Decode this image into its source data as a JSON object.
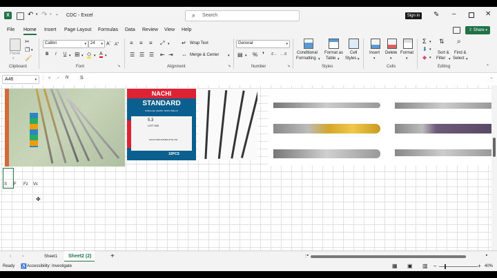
{
  "title": {
    "doc": "CDC",
    "app": "Excel"
  },
  "search": {
    "placeholder": "Search"
  },
  "account": {
    "sign_in": "Sign in"
  },
  "menu": [
    "File",
    "Home",
    "Insert",
    "Page Layout",
    "Formulas",
    "Data",
    "Review",
    "View",
    "Help"
  ],
  "share": "Share",
  "ribbon": {
    "paste": "Paste",
    "font_name": "Calibri",
    "font_size": "24",
    "wrap_text": "Wrap Text",
    "merge_center": "Merge & Center",
    "number_format": "General",
    "conditional": [
      "Conditional",
      "Formatting"
    ],
    "format_as_table": [
      "Format as",
      "Table"
    ],
    "cell_styles": [
      "Cell",
      "Styles"
    ],
    "insert": "Insert",
    "delete": "Delete",
    "format": "Format",
    "sort_filter": [
      "Sort &",
      "Filter"
    ],
    "find_select": [
      "Find &",
      "Select"
    ],
    "groups": [
      "Clipboard",
      "Font",
      "Alignment",
      "Number",
      "Styles",
      "Cells",
      "Editing"
    ]
  },
  "formula_bar": {
    "name_box": "A46",
    "fx": "fx",
    "content": "S"
  },
  "images": {
    "box_brand": "NACHI",
    "box_title": "STANDARD",
    "box_sub": "PARALLEL SHANK TWIST DRILLS",
    "box_company": "NACHI INDUSTRIES PTE.LTD.",
    "box_count": "10PCS",
    "box_size": "5.3",
    "box_sku": "LIST 500"
  },
  "cells": {
    "s": "S",
    "f": "F",
    "fz": "Fz",
    "vc": "Vc"
  },
  "sheets": [
    "Sheet1",
    "Sheet2 (2)"
  ],
  "status": {
    "ready": "Ready",
    "accessibility": "Accessibility: Investigate",
    "zoom": "40%"
  },
  "colors": {
    "excel_green": "#217346",
    "sign_in_bg": "#1a1a1a"
  }
}
